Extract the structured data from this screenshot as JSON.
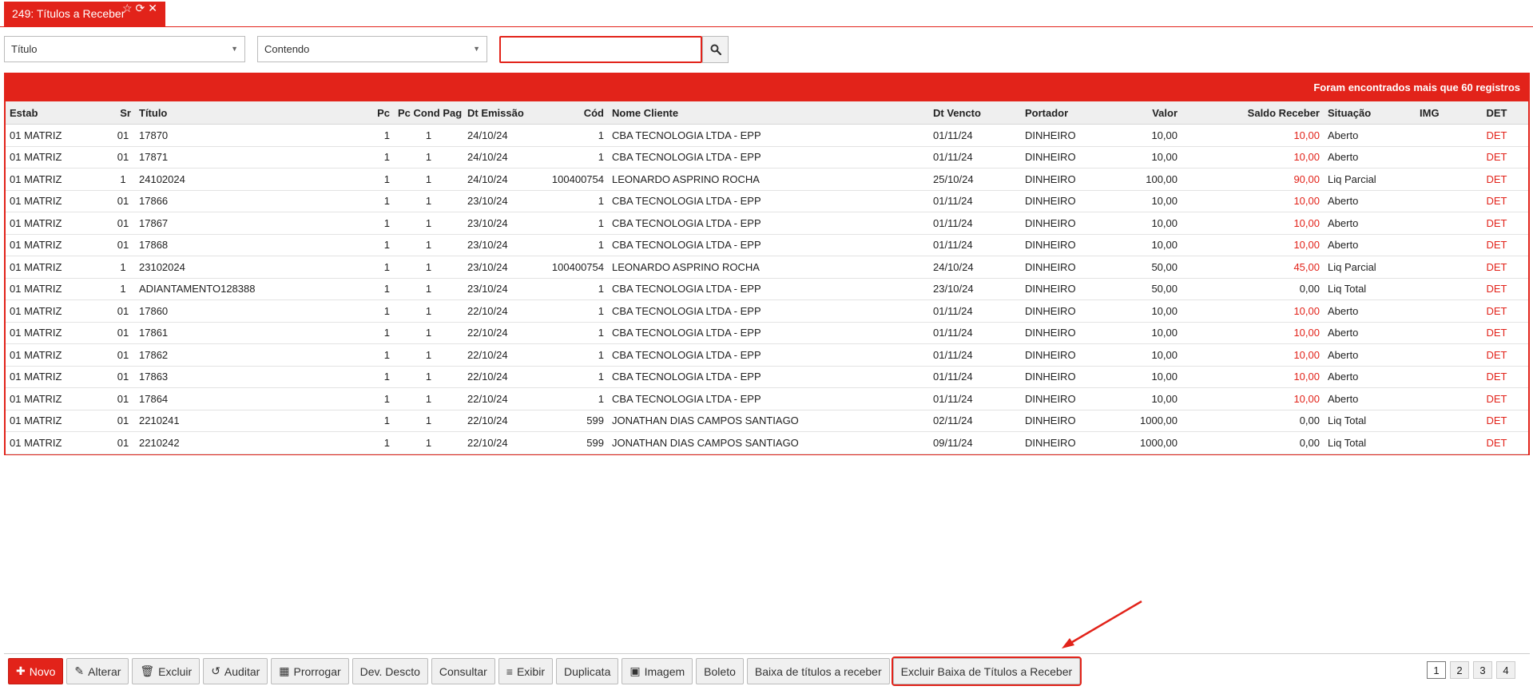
{
  "tab": {
    "title": "249: Títulos a Receber",
    "star": "☆",
    "refresh": "⟳",
    "close": "✕"
  },
  "filter": {
    "field": "Título",
    "operator": "Contendo",
    "search_value": "",
    "search_placeholder": ""
  },
  "grid": {
    "banner": "Foram encontrados mais que 60 registros",
    "columns": [
      "Estab",
      "Sr",
      "Título",
      "Pc",
      "Pc Cond Pag",
      "Dt Emissão",
      "Cód",
      "Nome Cliente",
      "Dt Vencto",
      "Portador",
      "Valor",
      "Saldo Receber",
      "Situação",
      "IMG",
      "DET"
    ],
    "rows": [
      [
        "01 MATRIZ",
        "01",
        "17870",
        "1",
        "1",
        "24/10/24",
        "1",
        "CBA TECNOLOGIA LTDA - EPP",
        "01/11/24",
        "DINHEIRO",
        "10,00",
        "10,00",
        "Aberto",
        "",
        "DET"
      ],
      [
        "01 MATRIZ",
        "01",
        "17871",
        "1",
        "1",
        "24/10/24",
        "1",
        "CBA TECNOLOGIA LTDA - EPP",
        "01/11/24",
        "DINHEIRO",
        "10,00",
        "10,00",
        "Aberto",
        "",
        "DET"
      ],
      [
        "01 MATRIZ",
        "1",
        "24102024",
        "1",
        "1",
        "24/10/24",
        "100400754",
        "LEONARDO ASPRINO ROCHA",
        "25/10/24",
        "DINHEIRO",
        "100,00",
        "90,00",
        "Liq Parcial",
        "",
        "DET"
      ],
      [
        "01 MATRIZ",
        "01",
        "17866",
        "1",
        "1",
        "23/10/24",
        "1",
        "CBA TECNOLOGIA LTDA - EPP",
        "01/11/24",
        "DINHEIRO",
        "10,00",
        "10,00",
        "Aberto",
        "",
        "DET"
      ],
      [
        "01 MATRIZ",
        "01",
        "17867",
        "1",
        "1",
        "23/10/24",
        "1",
        "CBA TECNOLOGIA LTDA - EPP",
        "01/11/24",
        "DINHEIRO",
        "10,00",
        "10,00",
        "Aberto",
        "",
        "DET"
      ],
      [
        "01 MATRIZ",
        "01",
        "17868",
        "1",
        "1",
        "23/10/24",
        "1",
        "CBA TECNOLOGIA LTDA - EPP",
        "01/11/24",
        "DINHEIRO",
        "10,00",
        "10,00",
        "Aberto",
        "",
        "DET"
      ],
      [
        "01 MATRIZ",
        "1",
        "23102024",
        "1",
        "1",
        "23/10/24",
        "100400754",
        "LEONARDO ASPRINO ROCHA",
        "24/10/24",
        "DINHEIRO",
        "50,00",
        "45,00",
        "Liq Parcial",
        "",
        "DET"
      ],
      [
        "01 MATRIZ",
        "1",
        "ADIANTAMENTO128388",
        "1",
        "1",
        "23/10/24",
        "1",
        "CBA TECNOLOGIA LTDA - EPP",
        "23/10/24",
        "DINHEIRO",
        "50,00",
        "0,00",
        "Liq Total",
        "",
        "DET"
      ],
      [
        "01 MATRIZ",
        "01",
        "17860",
        "1",
        "1",
        "22/10/24",
        "1",
        "CBA TECNOLOGIA LTDA - EPP",
        "01/11/24",
        "DINHEIRO",
        "10,00",
        "10,00",
        "Aberto",
        "",
        "DET"
      ],
      [
        "01 MATRIZ",
        "01",
        "17861",
        "1",
        "1",
        "22/10/24",
        "1",
        "CBA TECNOLOGIA LTDA - EPP",
        "01/11/24",
        "DINHEIRO",
        "10,00",
        "10,00",
        "Aberto",
        "",
        "DET"
      ],
      [
        "01 MATRIZ",
        "01",
        "17862",
        "1",
        "1",
        "22/10/24",
        "1",
        "CBA TECNOLOGIA LTDA - EPP",
        "01/11/24",
        "DINHEIRO",
        "10,00",
        "10,00",
        "Aberto",
        "",
        "DET"
      ],
      [
        "01 MATRIZ",
        "01",
        "17863",
        "1",
        "1",
        "22/10/24",
        "1",
        "CBA TECNOLOGIA LTDA - EPP",
        "01/11/24",
        "DINHEIRO",
        "10,00",
        "10,00",
        "Aberto",
        "",
        "DET"
      ],
      [
        "01 MATRIZ",
        "01",
        "17864",
        "1",
        "1",
        "22/10/24",
        "1",
        "CBA TECNOLOGIA LTDA - EPP",
        "01/11/24",
        "DINHEIRO",
        "10,00",
        "10,00",
        "Aberto",
        "",
        "DET"
      ],
      [
        "01 MATRIZ",
        "01",
        "2210241",
        "1",
        "1",
        "22/10/24",
        "599",
        "JONATHAN DIAS CAMPOS SANTIAGO",
        "02/11/24",
        "DINHEIRO",
        "1000,00",
        "0,00",
        "Liq Total",
        "",
        "DET"
      ],
      [
        "01 MATRIZ",
        "01",
        "2210242",
        "1",
        "1",
        "22/10/24",
        "599",
        "JONATHAN DIAS CAMPOS SANTIAGO",
        "09/11/24",
        "DINHEIRO",
        "1000,00",
        "0,00",
        "Liq Total",
        "",
        "DET"
      ]
    ]
  },
  "toolbar": {
    "buttons": [
      {
        "name": "novo-button",
        "icon": "plus-icon",
        "glyph": "✚",
        "label": "Novo",
        "primary": true
      },
      {
        "name": "alterar-button",
        "icon": "pencil-icon",
        "glyph": "✎",
        "label": "Alterar"
      },
      {
        "name": "excluir-button",
        "icon": "trash-icon",
        "glyph": "🗑",
        "label": "Excluir"
      },
      {
        "name": "auditar-button",
        "icon": "history-icon",
        "glyph": "↺",
        "label": "Auditar"
      },
      {
        "name": "prorrogar-button",
        "icon": "calendar-icon",
        "glyph": "▦",
        "label": "Prorrogar"
      },
      {
        "name": "dev-descto-button",
        "icon": "",
        "glyph": "",
        "label": "Dev. Descto"
      },
      {
        "name": "consultar-button",
        "icon": "",
        "glyph": "",
        "label": "Consultar"
      },
      {
        "name": "exibir-button",
        "icon": "list-icon",
        "glyph": "≡",
        "label": "Exibir"
      },
      {
        "name": "duplicata-button",
        "icon": "",
        "glyph": "",
        "label": "Duplicata"
      },
      {
        "name": "imagem-button",
        "icon": "image-icon",
        "glyph": "▣",
        "label": "Imagem"
      },
      {
        "name": "boleto-button",
        "icon": "",
        "glyph": "",
        "label": "Boleto"
      },
      {
        "name": "baixa-titulos-button",
        "icon": "",
        "glyph": "",
        "label": "Baixa de títulos a receber"
      },
      {
        "name": "excluir-baixa-titulos-button",
        "icon": "",
        "glyph": "",
        "label": "Excluir Baixa de Títulos a Receber",
        "highlight": true
      }
    ]
  },
  "pagination": {
    "pages": [
      "1",
      "2",
      "3",
      "4"
    ],
    "current": "1"
  },
  "colors": {
    "accent": "#e2231a"
  }
}
